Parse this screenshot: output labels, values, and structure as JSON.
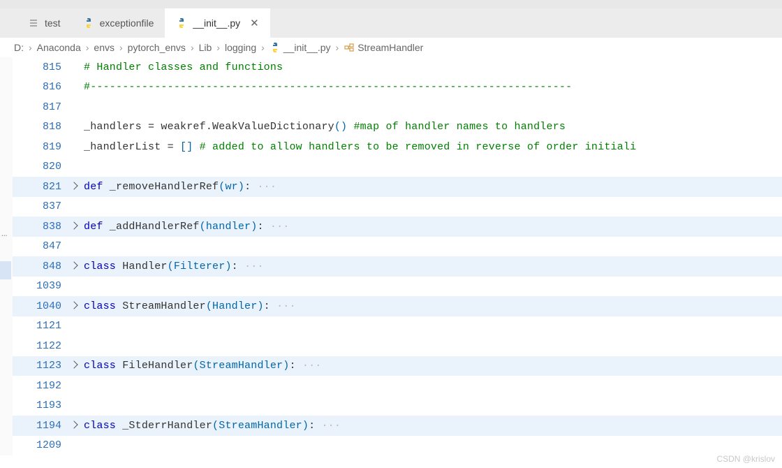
{
  "tabs": [
    {
      "label": "test",
      "icon": "list"
    },
    {
      "label": "exceptionfile",
      "icon": "python"
    },
    {
      "label": "__init__.py",
      "icon": "python",
      "active": true
    }
  ],
  "breadcrumb": {
    "parts": [
      "D:",
      "Anaconda",
      "envs",
      "pytorch_envs",
      "Lib",
      "logging"
    ],
    "file": "__init__.py",
    "symbol": "StreamHandler"
  },
  "lines": [
    {
      "n": "815",
      "type": "comment",
      "text": "#   Handler classes and functions"
    },
    {
      "n": "816",
      "type": "comment",
      "text": "#---------------------------------------------------------------------------"
    },
    {
      "n": "817",
      "type": "blank",
      "text": ""
    },
    {
      "n": "818",
      "type": "code",
      "prefix": "_handlers = weakref.WeakValueDictionary",
      "paren": "()",
      "suffix": "  #map of handler names to handlers"
    },
    {
      "n": "819",
      "type": "code2",
      "prefix": "_handlerList = ",
      "brack": "[]",
      "suffix": " # added to allow handlers to be removed in reverse of order initiali"
    },
    {
      "n": "820",
      "type": "blank",
      "text": ""
    },
    {
      "n": "821",
      "type": "def",
      "fold": true,
      "kw": "def",
      "name": " _removeHandlerRef",
      "args": "(wr)",
      "tail": ": "
    },
    {
      "n": "837",
      "type": "blank",
      "text": ""
    },
    {
      "n": "838",
      "type": "def",
      "fold": true,
      "kw": "def",
      "name": " _addHandlerRef",
      "args": "(handler)",
      "tail": ": "
    },
    {
      "n": "847",
      "type": "blank",
      "text": ""
    },
    {
      "n": "848",
      "type": "class",
      "fold": true,
      "kw": "class",
      "name": " Handler",
      "args": "(Filterer)",
      "tail": ": "
    },
    {
      "n": "1039",
      "type": "blank",
      "text": ""
    },
    {
      "n": "1040",
      "type": "class",
      "fold": true,
      "kw": "class",
      "name": " StreamHandler",
      "args": "(Handler)",
      "tail": ": "
    },
    {
      "n": "1121",
      "type": "blank",
      "text": ""
    },
    {
      "n": "1122",
      "type": "blank",
      "text": ""
    },
    {
      "n": "1123",
      "type": "class",
      "fold": true,
      "kw": "class",
      "name": " FileHandler",
      "args": "(StreamHandler)",
      "tail": ": "
    },
    {
      "n": "1192",
      "type": "blank",
      "text": ""
    },
    {
      "n": "1193",
      "type": "blank",
      "text": ""
    },
    {
      "n": "1194",
      "type": "class",
      "fold": true,
      "kw": "class",
      "name": " _StderrHandler",
      "args": "(StreamHandler)",
      "tail": ": "
    },
    {
      "n": "1209",
      "type": "blank",
      "text": ""
    }
  ],
  "watermark": "CSDN @krislov",
  "ellipsis": "…"
}
